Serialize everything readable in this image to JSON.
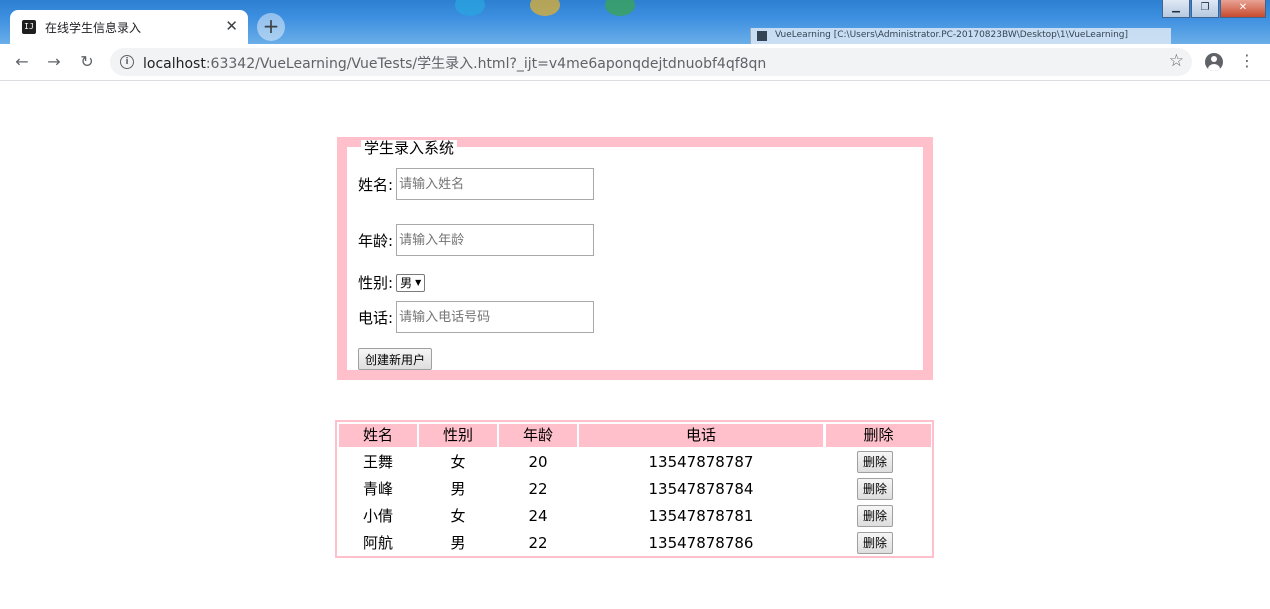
{
  "browser": {
    "tab_title": "在线学生信息录入",
    "tab_icon_text": "IJ",
    "url_host": "localhost",
    "url_rest": ":63342/VueLearning/VueTests/学生录入.html?_ijt=v4me6aponqdejtdnuobf4qf8qn",
    "desktop_strip_text": "VueLearning [C:\\Users\\Administrator.PC-20170823BW\\Desktop\\1\\VueLearning]"
  },
  "form": {
    "legend": "学生录入系统",
    "name_label": "姓名:",
    "name_placeholder": "请输入姓名",
    "age_label": "年龄:",
    "age_placeholder": "请输入年龄",
    "gender_label": "性别:",
    "gender_value": "男",
    "phone_label": "电话:",
    "phone_placeholder": "请输入电话号码",
    "create_button": "创建新用户"
  },
  "table": {
    "headers": [
      "姓名",
      "性别",
      "年龄",
      "电话",
      "删除"
    ],
    "rows": [
      {
        "name": "王舞",
        "gender": "女",
        "age": "20",
        "phone": "13547878787",
        "delete_label": "删除"
      },
      {
        "name": "青峰",
        "gender": "男",
        "age": "22",
        "phone": "13547878784",
        "delete_label": "删除"
      },
      {
        "name": "小倩",
        "gender": "女",
        "age": "24",
        "phone": "13547878781",
        "delete_label": "删除"
      },
      {
        "name": "阿航",
        "gender": "男",
        "age": "22",
        "phone": "13547878786",
        "delete_label": "删除"
      }
    ]
  },
  "colors": {
    "accent_pink": "#ffc0cb"
  }
}
